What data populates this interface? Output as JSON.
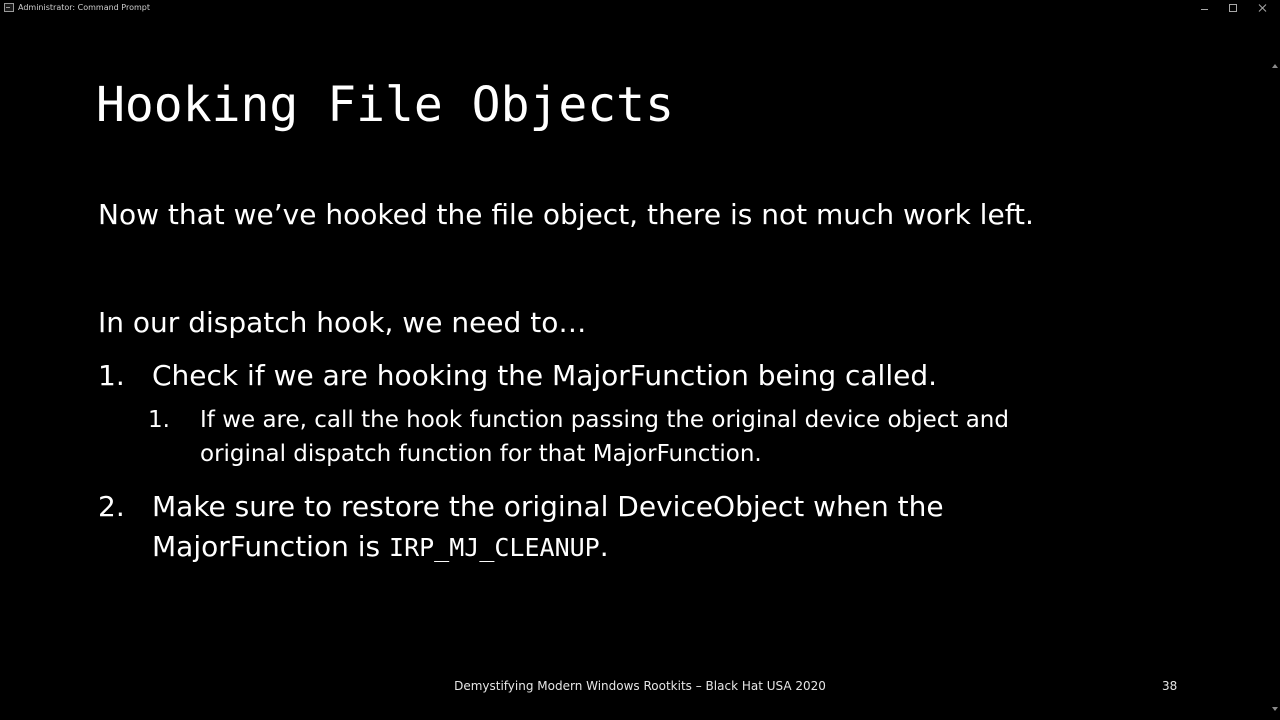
{
  "window": {
    "title": "Administrator: Command Prompt",
    "app_icon": "cmd-icon"
  },
  "slide": {
    "title": "Hooking File Objects",
    "intro": "Now that we’ve hooked the file object, there is not much work left.",
    "lead": "In our dispatch hook, we need to…",
    "items": [
      {
        "number": "1.",
        "text": "Check if we are hooking the MajorFunction being called.",
        "subitems": [
          {
            "number": "1.",
            "line1": "If we are, call the hook function passing the original device object and",
            "line2": "original dispatch function for that MajorFunction."
          }
        ]
      },
      {
        "number": "2.",
        "line1": "Make sure to restore the original DeviceObject when the",
        "line2_prefix": "MajorFunction is ",
        "line2_code": "IRP_MJ_CLEANUP",
        "line2_suffix": "."
      }
    ],
    "footer": "Demystifying Modern Windows Rootkits – Black Hat USA 2020",
    "page_number": "38"
  },
  "colors": {
    "background": "#000000",
    "text": "#ffffff",
    "footer_text": "#e6e6e6"
  }
}
